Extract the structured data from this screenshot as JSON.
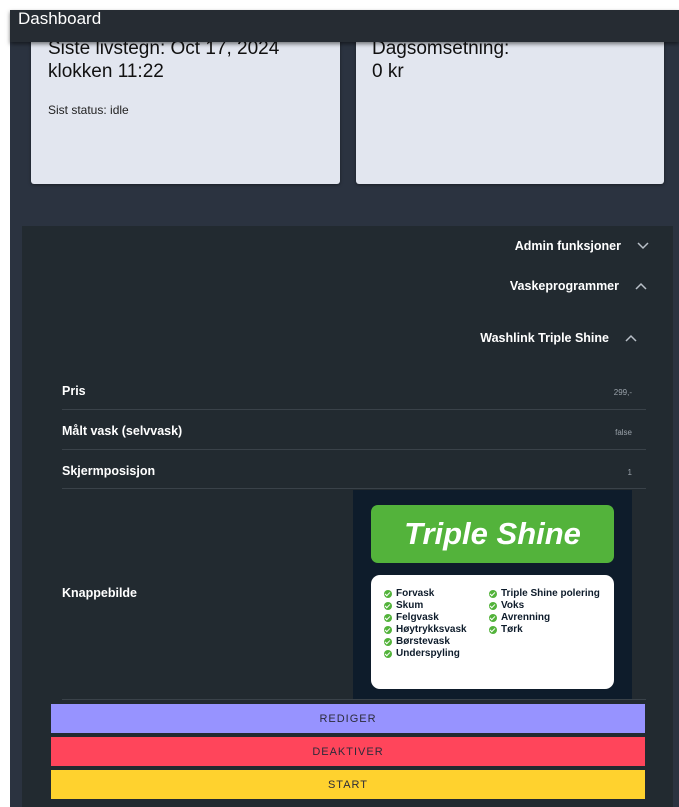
{
  "header": {
    "title": "Dashboard"
  },
  "cards": {
    "heartbeat": {
      "line1": "Siste livstegn: Oct 17, 2024",
      "line2": "klokken 11:22",
      "status": "Sist status: idle"
    },
    "revenue": {
      "line1": "Dagsomsetning:",
      "line2": "0 kr"
    }
  },
  "accordion": {
    "admin": {
      "label": "Admin funksjoner",
      "icon": "chevron-down-icon"
    },
    "programs": {
      "label": "Vaskeprogrammer",
      "icon": "chevron-up-icon"
    },
    "program": {
      "label": "Washlink Triple Shine",
      "icon": "chevron-up-icon"
    }
  },
  "details": [
    {
      "label": "Pris",
      "value": "299,-"
    },
    {
      "label": "Målt vask (selvvask)",
      "value": "false"
    },
    {
      "label": "Skjermposisjon",
      "value": "1"
    },
    {
      "label": "Knappebilde",
      "value": ""
    }
  ],
  "button_image": {
    "title": "Triple Shine",
    "features_left": [
      "Forvask",
      "Skum",
      "Felgvask",
      "Høytrykksvask",
      "Børstevask",
      "Underspyling"
    ],
    "features_right": [
      "Triple Shine polering",
      "Voks",
      "Avrenning",
      "Tørk"
    ],
    "colors": {
      "banner": "#53b33b",
      "background": "#0e1c2b"
    }
  },
  "actions": {
    "edit": "REDIGER",
    "deactivate": "DEAKTIVER",
    "start": "START"
  },
  "colors": {
    "edit": "#9793ff",
    "deactivate": "#ff455b",
    "start": "#ffd22e"
  }
}
